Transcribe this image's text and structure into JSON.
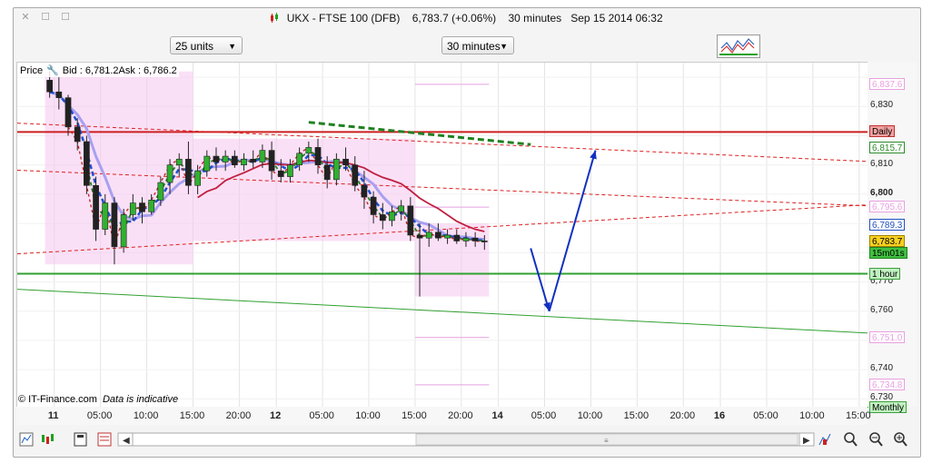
{
  "window": {
    "title": "UKX - FTSE 100 (DFB)",
    "price": "6,783.7 (+0.06%)",
    "interval": "30 minutes",
    "datetime": "Sep 15 2014 06:32"
  },
  "toolbar": {
    "units_select": "25 units",
    "interval_select": "30 minutes"
  },
  "info": {
    "price_label": "Price",
    "bid": "Bid : 6,781.2",
    "ask": "Ask : 6,786.2"
  },
  "footer": {
    "copyright": "© IT-Finance.com",
    "note": "Data is indicative"
  },
  "right_labels": [
    {
      "text": "6,837.6",
      "value": 6837.6,
      "bg": "#ffffff",
      "border": "#e8a0e0",
      "color": "#e8a0e0"
    },
    {
      "text": "Daily",
      "value": 6821.3,
      "bg": "#f0a0a0",
      "border": "#c03030",
      "color": "#000000"
    },
    {
      "text": "6,815.7",
      "value": 6815.7,
      "bg": "#ffffff",
      "border": "#2e8b2e",
      "color": "#2e8b2e"
    },
    {
      "text": "6,795.6",
      "value": 6795.6,
      "bg": "#ffffff",
      "border": "#e8a0e0",
      "color": "#e8a0e0"
    },
    {
      "text": "6,789.3",
      "value": 6789.3,
      "bg": "#ffffff",
      "border": "#2050c0",
      "color": "#2050c0"
    },
    {
      "text": "6,783.7",
      "value": 6783.7,
      "bg": "#f8d020",
      "border": "#a08000",
      "color": "#000000"
    },
    {
      "text": "15m01s",
      "value": 6779.7,
      "bg": "#40c040",
      "border": "#208020",
      "color": "#000000"
    },
    {
      "text": "1 hour",
      "value": 6772.8,
      "bg": "#c0f0c0",
      "border": "#40a040",
      "color": "#000000"
    },
    {
      "text": "6,751.0",
      "value": 6751.0,
      "bg": "#ffffff",
      "border": "#e8a0e0",
      "color": "#e8a0e0"
    },
    {
      "text": "6,734.8",
      "value": 6734.8,
      "bg": "#ffffff",
      "border": "#e8a0e0",
      "color": "#e8a0e0"
    },
    {
      "text": "Monthly",
      "value": 6727.0,
      "bg": "#c0f0c0",
      "border": "#40a040",
      "color": "#000000"
    }
  ],
  "chart_data": {
    "type": "candlestick",
    "title": "UKX - FTSE 100 (DFB)",
    "interval": "30 minutes",
    "y_ticks": [
      6730,
      6740,
      6750,
      6760,
      6770,
      6780,
      6790,
      6800,
      6810,
      6820,
      6830,
      6840
    ],
    "y_tick_labels": [
      "6,730",
      "6,740",
      "",
      "6,760",
      "6,770",
      "",
      "",
      "6,800",
      "6,810",
      "",
      "6,830",
      ""
    ],
    "ylim": [
      6727,
      6845
    ],
    "x_ticks": [
      {
        "label": "11",
        "bold": true,
        "t": 0.5
      },
      {
        "label": "05:00",
        "bold": false,
        "t": 5.5
      },
      {
        "label": "10:00",
        "bold": false,
        "t": 10.5
      },
      {
        "label": "15:00",
        "bold": false,
        "t": 15.5
      },
      {
        "label": "20:00",
        "bold": false,
        "t": 20.5
      },
      {
        "label": "12",
        "bold": true,
        "t": 24.5
      },
      {
        "label": "05:00",
        "bold": false,
        "t": 29.5
      },
      {
        "label": "10:00",
        "bold": false,
        "t": 34.5
      },
      {
        "label": "15:00",
        "bold": false,
        "t": 39.5
      },
      {
        "label": "20:00",
        "bold": false,
        "t": 44.5
      },
      {
        "label": "14",
        "bold": true,
        "t": 48.5
      },
      {
        "label": "05:00",
        "bold": false,
        "t": 53.5
      },
      {
        "label": "10:00",
        "bold": false,
        "t": 58.5
      },
      {
        "label": "15:00",
        "bold": false,
        "t": 63.5
      },
      {
        "label": "20:00",
        "bold": false,
        "t": 68.5
      },
      {
        "label": "16",
        "bold": true,
        "t": 72.5
      },
      {
        "label": "05:00",
        "bold": false,
        "t": 77.5
      },
      {
        "label": "10:00",
        "bold": false,
        "t": 82.5
      },
      {
        "label": "15:00",
        "bold": false,
        "t": 87.5
      }
    ],
    "x_range": [
      -3.5,
      88.5
    ],
    "candles": [
      [
        6839,
        6842,
        6833,
        6835
      ],
      [
        6835,
        6840,
        6829,
        6833
      ],
      [
        6833,
        6834,
        6820,
        6823
      ],
      [
        6823,
        6826,
        6815,
        6818
      ],
      [
        6818,
        6820,
        6800,
        6803
      ],
      [
        6803,
        6806,
        6784,
        6788
      ],
      [
        6788,
        6800,
        6786,
        6797
      ],
      [
        6797,
        6799,
        6776,
        6782
      ],
      [
        6782,
        6795,
        6780,
        6793
      ],
      [
        6793,
        6800,
        6791,
        6797
      ],
      [
        6797,
        6799,
        6790,
        6794
      ],
      [
        6794,
        6800,
        6793,
        6798
      ],
      [
        6798,
        6806,
        6796,
        6804
      ],
      [
        6804,
        6812,
        6800,
        6810
      ],
      [
        6810,
        6814,
        6806,
        6812
      ],
      [
        6812,
        6818,
        6800,
        6803
      ],
      [
        6803,
        6810,
        6800,
        6808
      ],
      [
        6808,
        6815,
        6806,
        6813
      ],
      [
        6813,
        6816,
        6808,
        6811
      ],
      [
        6811,
        6815,
        6808,
        6813
      ],
      [
        6813,
        6815,
        6809,
        6810
      ],
      [
        6810,
        6814,
        6808,
        6812
      ],
      [
        6812,
        6815,
        6809,
        6811
      ],
      [
        6811,
        6817,
        6809,
        6815
      ],
      [
        6815,
        6818,
        6805,
        6808
      ],
      [
        6808,
        6812,
        6804,
        6806
      ],
      [
        6806,
        6812,
        6804,
        6810
      ],
      [
        6810,
        6816,
        6808,
        6814
      ],
      [
        6814,
        6818,
        6811,
        6816
      ],
      [
        6816,
        6819,
        6807,
        6810
      ],
      [
        6810,
        6813,
        6802,
        6805
      ],
      [
        6805,
        6814,
        6803,
        6812
      ],
      [
        6812,
        6816,
        6808,
        6810
      ],
      [
        6810,
        6813,
        6801,
        6803
      ],
      [
        6803,
        6808,
        6795,
        6799
      ],
      [
        6799,
        6801,
        6790,
        6793
      ],
      [
        6793,
        6797,
        6788,
        6791
      ],
      [
        6791,
        6796,
        6789,
        6794
      ],
      [
        6794,
        6798,
        6791,
        6796
      ],
      [
        6796,
        6799,
        6784,
        6786
      ],
      [
        6786,
        6790,
        6765,
        6785
      ],
      [
        6785,
        6790,
        6782,
        6787
      ],
      [
        6787,
        6790,
        6784,
        6785
      ],
      [
        6785,
        6788,
        6783,
        6786
      ],
      [
        6786,
        6788,
        6783,
        6784
      ],
      [
        6784,
        6787,
        6782,
        6785
      ],
      [
        6785,
        6787,
        6782,
        6784
      ],
      [
        6784,
        6786,
        6781,
        6783.7
      ]
    ],
    "levels": [
      {
        "name": "Daily",
        "y0": 6821.3,
        "y1": 6821.3,
        "color": "#cc2020",
        "width": 2,
        "dash": ""
      },
      {
        "name": "1 hour",
        "y0": 6772.8,
        "y1": 6772.8,
        "color": "#30a030",
        "width": 2,
        "dash": ""
      },
      {
        "name": "Monthly",
        "y0": 6727.0,
        "y1": 6727.0,
        "color": "#30a030",
        "width": 2,
        "dash": ""
      },
      {
        "name": "",
        "y0": 6767.5,
        "y1": 6752.5,
        "color": "#30a030",
        "width": 1,
        "dash": ""
      },
      {
        "name": "",
        "y0": 6824.3,
        "y1": 6811.2,
        "color": "#dd2020",
        "width": 1,
        "dash": "4,3"
      },
      {
        "name": "",
        "y0": 6808.2,
        "y1": 6796.0,
        "color": "#dd2020",
        "width": 1,
        "dash": "4,3"
      },
      {
        "name": "",
        "y0": 6779.6,
        "y1": 6796.4,
        "color": "#dd2020",
        "width": 1,
        "dash": "4,3"
      }
    ],
    "green_resistance": [
      [
        28.0,
        6824.6
      ],
      [
        52.0,
        6817.0
      ]
    ],
    "arrows": [
      {
        "from": [
          52.0,
          6781.5
        ],
        "to": [
          54.0,
          6760.0
        ]
      },
      {
        "from": [
          54.0,
          6760.0
        ],
        "to": [
          59.0,
          6815.0
        ]
      }
    ]
  },
  "bottombar": {
    "icons": [
      "bar-chart-icon",
      "candles-icon",
      "save-icon",
      "indicators-icon",
      "drawing-icon",
      "zoom-fit-icon",
      "zoom-out-icon",
      "zoom-in-icon"
    ]
  }
}
